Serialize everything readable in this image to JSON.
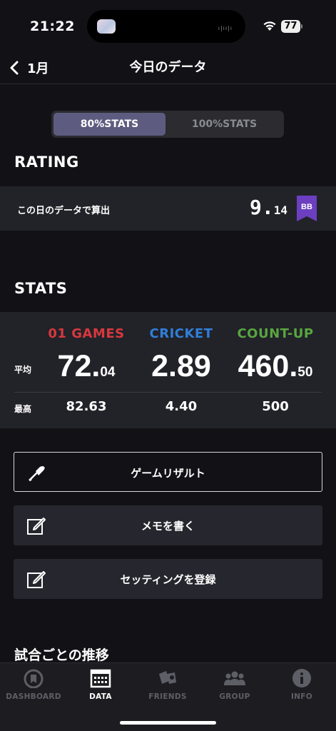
{
  "status_bar": {
    "time": "21:22",
    "battery": "77"
  },
  "nav": {
    "back_label": "1月",
    "title": "今日のデータ"
  },
  "stats_toggle": {
    "options": [
      "80%STATS",
      "100%STATS"
    ],
    "selected": "80%STATS"
  },
  "rating": {
    "heading": "RATING",
    "label": "この日のデータで算出",
    "value_int": "9.",
    "value_dec": "14",
    "badge": "BB",
    "badge_color": "#6b3fc0"
  },
  "stats": {
    "heading": "STATS",
    "row_labels": {
      "average": "平均",
      "max": "最高"
    },
    "games": [
      {
        "name": "01 GAMES",
        "color": "#d7383d",
        "avg_int": "72.",
        "avg_dec": "04",
        "max": "82.63"
      },
      {
        "name": "CRICKET",
        "color": "#2f7fd8",
        "avg_int": "2.89",
        "avg_dec": "",
        "max": "4.40"
      },
      {
        "name": "COUNT-UP",
        "color": "#58a63f",
        "avg_int": "460.",
        "avg_dec": "50",
        "max": "500"
      }
    ]
  },
  "actions": [
    {
      "label": "ゲームリザルト",
      "icon": "dart-icon"
    },
    {
      "label": "メモを書く",
      "icon": "edit-icon"
    },
    {
      "label": "セッティングを登録",
      "icon": "edit-icon"
    }
  ],
  "trend_heading": "試合ごとの推移",
  "tabs": [
    {
      "label": "DASHBOARD",
      "icon": "dashboard-icon",
      "active": false
    },
    {
      "label": "DATA",
      "icon": "calendar-icon",
      "active": true
    },
    {
      "label": "FRIENDS",
      "icon": "friends-icon",
      "active": false
    },
    {
      "label": "GROUP",
      "icon": "group-icon",
      "active": false
    },
    {
      "label": "INFO",
      "icon": "info-icon",
      "active": false
    }
  ]
}
